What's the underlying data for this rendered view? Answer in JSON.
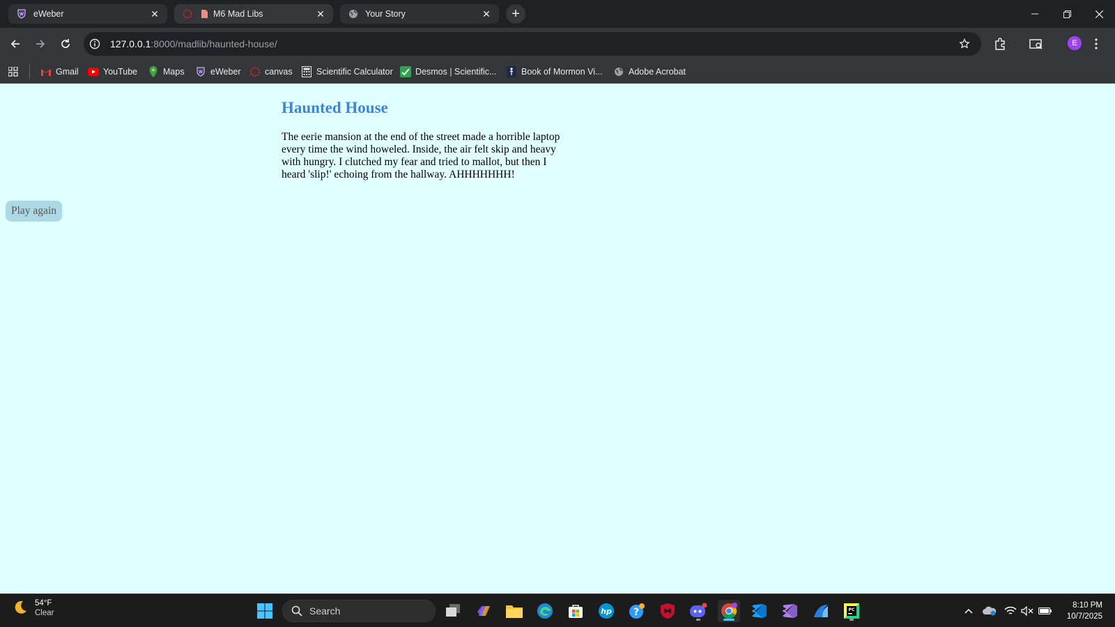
{
  "browser": {
    "tabs": [
      {
        "title": "eWeber",
        "favicon": "eweber-shield-icon"
      },
      {
        "title": "M6 Mad Libs",
        "favicon": "canvas-icon"
      },
      {
        "title": "Your Story",
        "favicon": "globe-icon"
      }
    ],
    "url_host": "127.0.0.1",
    "url_rest": ":8000/madlib/haunted-house/",
    "profile_initial": "E",
    "bookmarks": [
      {
        "label": "Gmail",
        "icon": "gmail-icon"
      },
      {
        "label": "YouTube",
        "icon": "youtube-icon"
      },
      {
        "label": "Maps",
        "icon": "maps-icon"
      },
      {
        "label": "eWeber",
        "icon": "eweber-shield-icon"
      },
      {
        "label": "canvas",
        "icon": "canvas-icon"
      },
      {
        "label": "Scientific Calculator",
        "icon": "calculator-icon"
      },
      {
        "label": "Desmos | Scientific...",
        "icon": "desmos-icon"
      },
      {
        "label": "Book of Mormon Vi...",
        "icon": "bookmark-figure-icon"
      },
      {
        "label": "Adobe Acrobat",
        "icon": "globe-icon"
      }
    ]
  },
  "page": {
    "title": "Haunted House",
    "story": "The eerie mansion at the end of the street made a horrible laptop every time the wind howeled. Inside, the air felt skip and heavy with hungry. I clutched my fear and tried to mallot, but then I heard 'slip!' echoing from the hallway. AHHHHHHH!",
    "play_again_label": "Play again"
  },
  "taskbar": {
    "weather_temp": "54°F",
    "weather_condition": "Clear",
    "search_placeholder": "Search",
    "time": "8:10 PM",
    "date": "10/7/2025"
  }
}
